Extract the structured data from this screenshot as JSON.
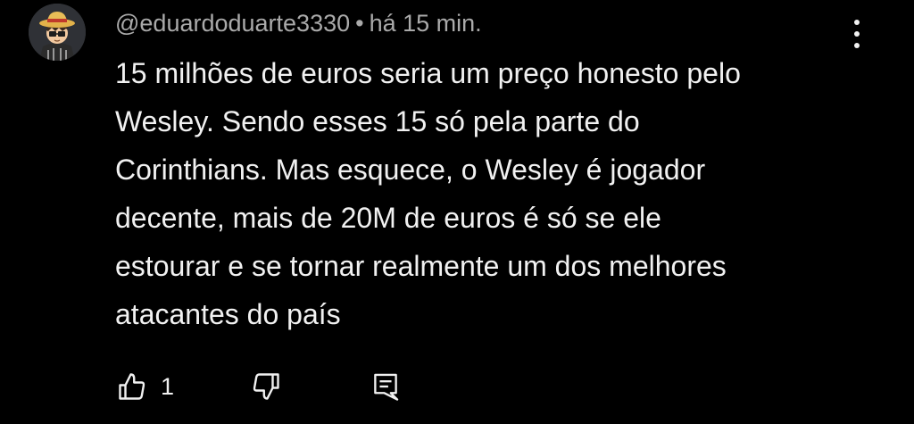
{
  "comment": {
    "author": "@eduardoduarte3330",
    "separator": "•",
    "time": "há 15 min.",
    "text": "15 milhões de euros seria um preço honesto pelo\nWesley. Sendo esses 15 só pela parte do\nCorinthians. Mas esquece, o Wesley é jogador\ndecente, mais de 20M de euros é só se ele\nestourar e se tornar realmente um dos melhores\natacantes do país",
    "like_count": "1"
  },
  "icons": {
    "avatar": "avatar-straw-hat-character",
    "menu": "more-vertical-icon",
    "like": "thumbs-up-icon",
    "dislike": "thumbs-down-icon",
    "reply": "comment-reply-icon"
  },
  "colors": {
    "background": "#000000",
    "text": "#f1f1f1",
    "meta": "#aaaaaa"
  }
}
